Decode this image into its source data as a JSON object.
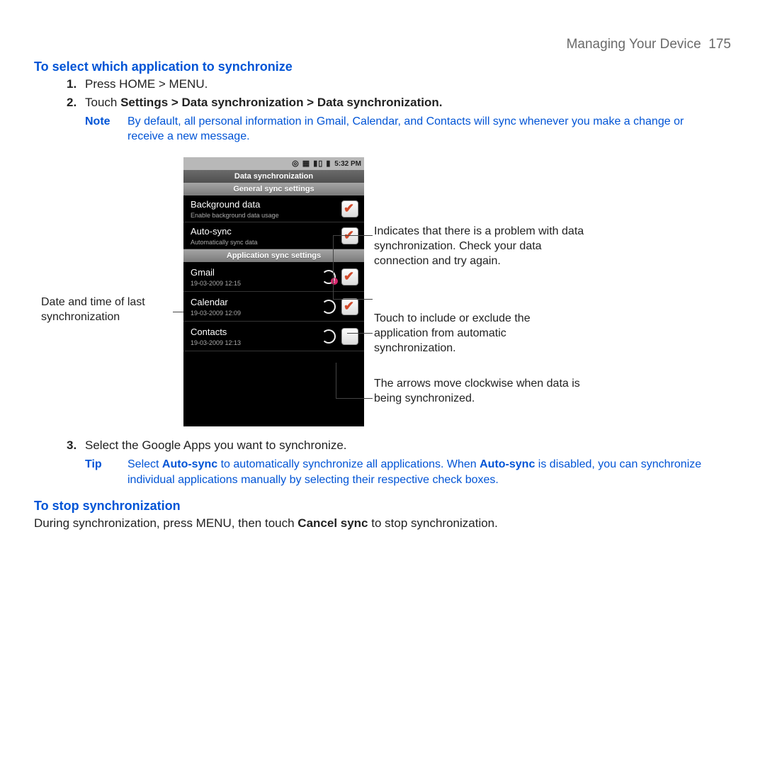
{
  "header": {
    "chapter": "Managing Your Device",
    "page": "175"
  },
  "section1": {
    "title": "To select which application to synchronize",
    "step1": {
      "num": "1.",
      "text": "Press HOME > MENU."
    },
    "step2": {
      "num": "2.",
      "prefix": "Touch ",
      "bold": "Settings > Data synchronization > Data synchronization."
    },
    "note": {
      "label": "Note",
      "text": "By default, all personal information in Gmail, Calendar, and Contacts will sync whenever you make a change or receive a new message."
    },
    "step3": {
      "num": "3.",
      "text": "Select the Google Apps you want to synchronize."
    },
    "tip": {
      "label": "Tip",
      "pre": "Select ",
      "b1": "Auto-sync",
      "mid": " to automatically synchronize all applications. When ",
      "b2": "Auto-sync",
      "post": " is disabled, you can synchronize individual applications manually by selecting their respective check boxes."
    }
  },
  "section2": {
    "title": "To stop synchronization",
    "text_pre": "During synchronization, press MENU, then touch ",
    "text_bold": "Cancel sync",
    "text_post": " to stop synchronization."
  },
  "callouts": {
    "left1": "Date and time of last synchronization",
    "right1": "Indicates that there is a problem with data synchronization. Check your data connection and try again.",
    "right2": "Touch to include or exclude the application from automatic synchronization.",
    "right3": "The arrows move clockwise when data is being synchronized."
  },
  "phone": {
    "status_time": "5:32 PM",
    "screen_title": "Data synchronization",
    "subhead1": "General sync settings",
    "subhead2": "Application sync settings",
    "rows": {
      "bg": {
        "title": "Background data",
        "sub": "Enable background data usage"
      },
      "auto": {
        "title": "Auto-sync",
        "sub": "Automatically sync data"
      },
      "gmail": {
        "title": "Gmail",
        "sub": "19-03-2009 12:15"
      },
      "calendar": {
        "title": "Calendar",
        "sub": "19-03-2009 12:09"
      },
      "contacts": {
        "title": "Contacts",
        "sub": "19-03-2009 12:13"
      }
    }
  }
}
